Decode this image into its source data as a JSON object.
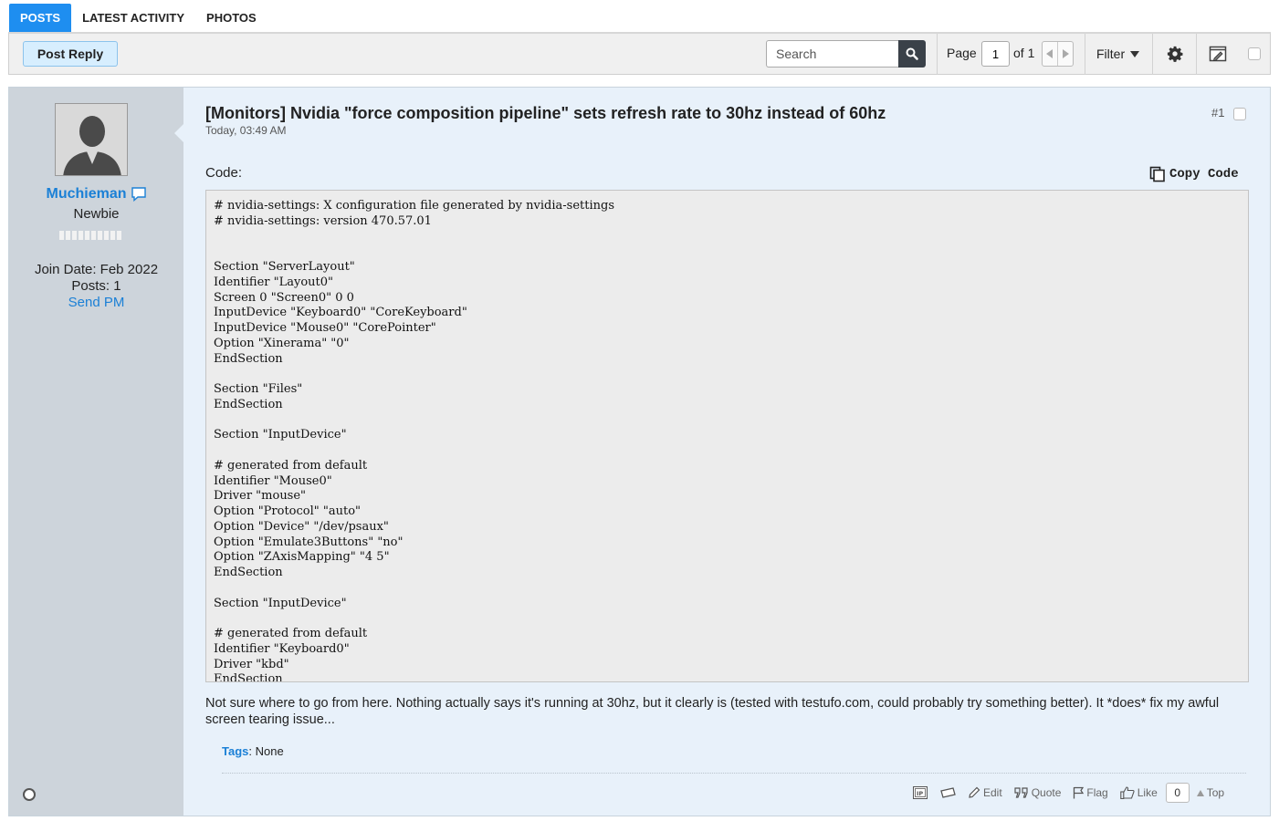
{
  "tabs": [
    {
      "label": "POSTS",
      "active": true
    },
    {
      "label": "LATEST ACTIVITY",
      "active": false
    },
    {
      "label": "PHOTOS",
      "active": false
    }
  ],
  "toolbar": {
    "post_reply_label": "Post Reply",
    "search_placeholder": "Search",
    "page_label": "Page",
    "page_value": "1",
    "page_of": "of 1",
    "filter_label": "Filter"
  },
  "user": {
    "name": "Muchieman",
    "title": "Newbie",
    "join_date": "Join Date: Feb 2022",
    "posts": "Posts: 1",
    "send_pm": "Send PM"
  },
  "post": {
    "title": "[Monitors] Nvidia \"force composition pipeline\" sets refresh rate to 30hz instead of 60hz",
    "date": "Today, 03:49 AM",
    "number": "#1",
    "code_label": "Code:",
    "copy_code_label": "Copy Code",
    "code": "# nvidia-settings: X configuration file generated by nvidia-settings\n# nvidia-settings: version 470.57.01\n\n\nSection \"ServerLayout\"\nIdentifier \"Layout0\"\nScreen 0 \"Screen0\" 0 0\nInputDevice \"Keyboard0\" \"CoreKeyboard\"\nInputDevice \"Mouse0\" \"CorePointer\"\nOption \"Xinerama\" \"0\"\nEndSection\n\nSection \"Files\"\nEndSection\n\nSection \"InputDevice\"\n\n# generated from default\nIdentifier \"Mouse0\"\nDriver \"mouse\"\nOption \"Protocol\" \"auto\"\nOption \"Device\" \"/dev/psaux\"\nOption \"Emulate3Buttons\" \"no\"\nOption \"ZAxisMapping\" \"4 5\"\nEndSection\n\nSection \"InputDevice\"\n\n# generated from default\nIdentifier \"Keyboard0\"\nDriver \"kbd\"\nEndSection",
    "body": "Not sure where to go from here. Nothing actually says it's running at 30hz, but it clearly is (tested with testufo.com, could probably try something better). It *does* fix my awful screen tearing issue...",
    "tags_label": "Tags",
    "tags_value": ": None"
  },
  "actions": {
    "edit": "Edit",
    "quote": "Quote",
    "flag": "Flag",
    "like": "Like",
    "like_count": "0",
    "top": "Top"
  }
}
